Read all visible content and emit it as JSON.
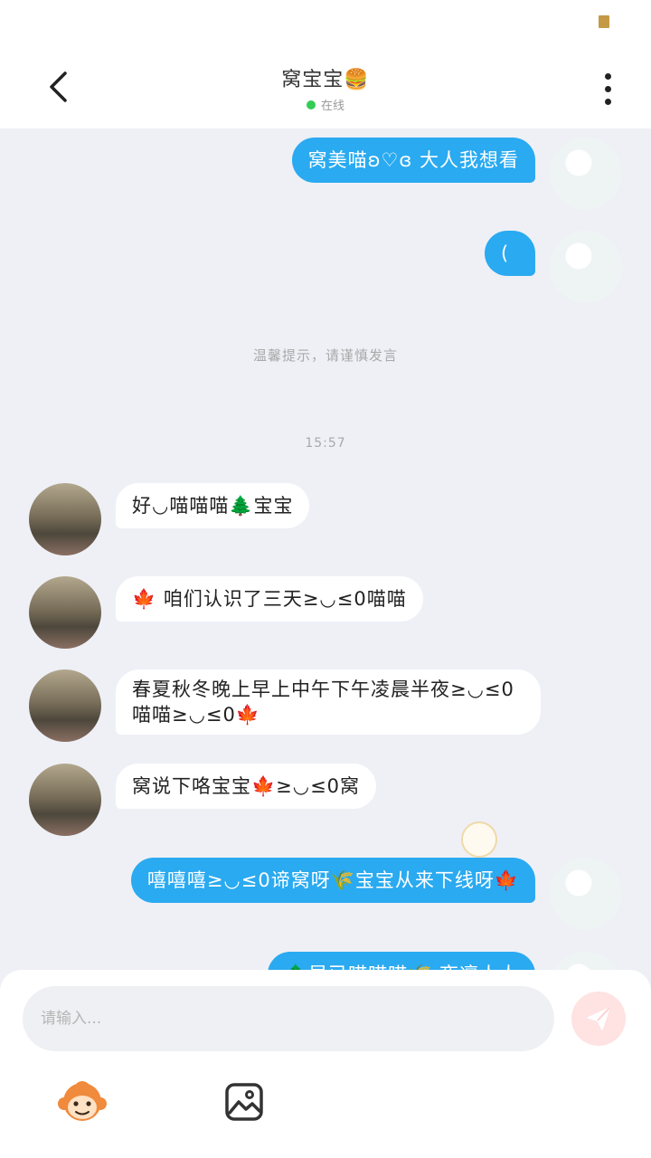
{
  "header": {
    "title": "窝宝宝🍔",
    "status": "在线"
  },
  "messages": [
    {
      "side": "out",
      "text": "窝美喵ʚ♡ɞ 大人我想看"
    },
    {
      "side": "out",
      "text": "("
    },
    {
      "side": "in",
      "text": "好◡喵喵喵🌲宝宝"
    },
    {
      "side": "in",
      "text": "🍁 咱们认识了三天≥◡≤0喵喵"
    },
    {
      "side": "in",
      "text": "春夏秋冬晚上早上中午下午凌晨半夜≥◡≤0喵喵≥◡≤0🍁"
    },
    {
      "side": "in",
      "text": "窝说下咯宝宝🍁≥◡≤0窝"
    },
    {
      "side": "out",
      "text": "嘻嘻嘻≥◡≤0谛窝呀🌾宝宝从来下线呀🍁"
    },
    {
      "side": "out",
      "text": "🌲早已喵喵喵🌾 夜凛人人"
    }
  ],
  "notices": {
    "tip": "温馨提示，请谨慎发言",
    "time": "15:57"
  },
  "composer": {
    "placeholder": "请输入..."
  },
  "colors": {
    "outgoing_bubble": "#2aaaf0",
    "incoming_bubble": "#ffffff",
    "online_dot": "#33cc55"
  }
}
